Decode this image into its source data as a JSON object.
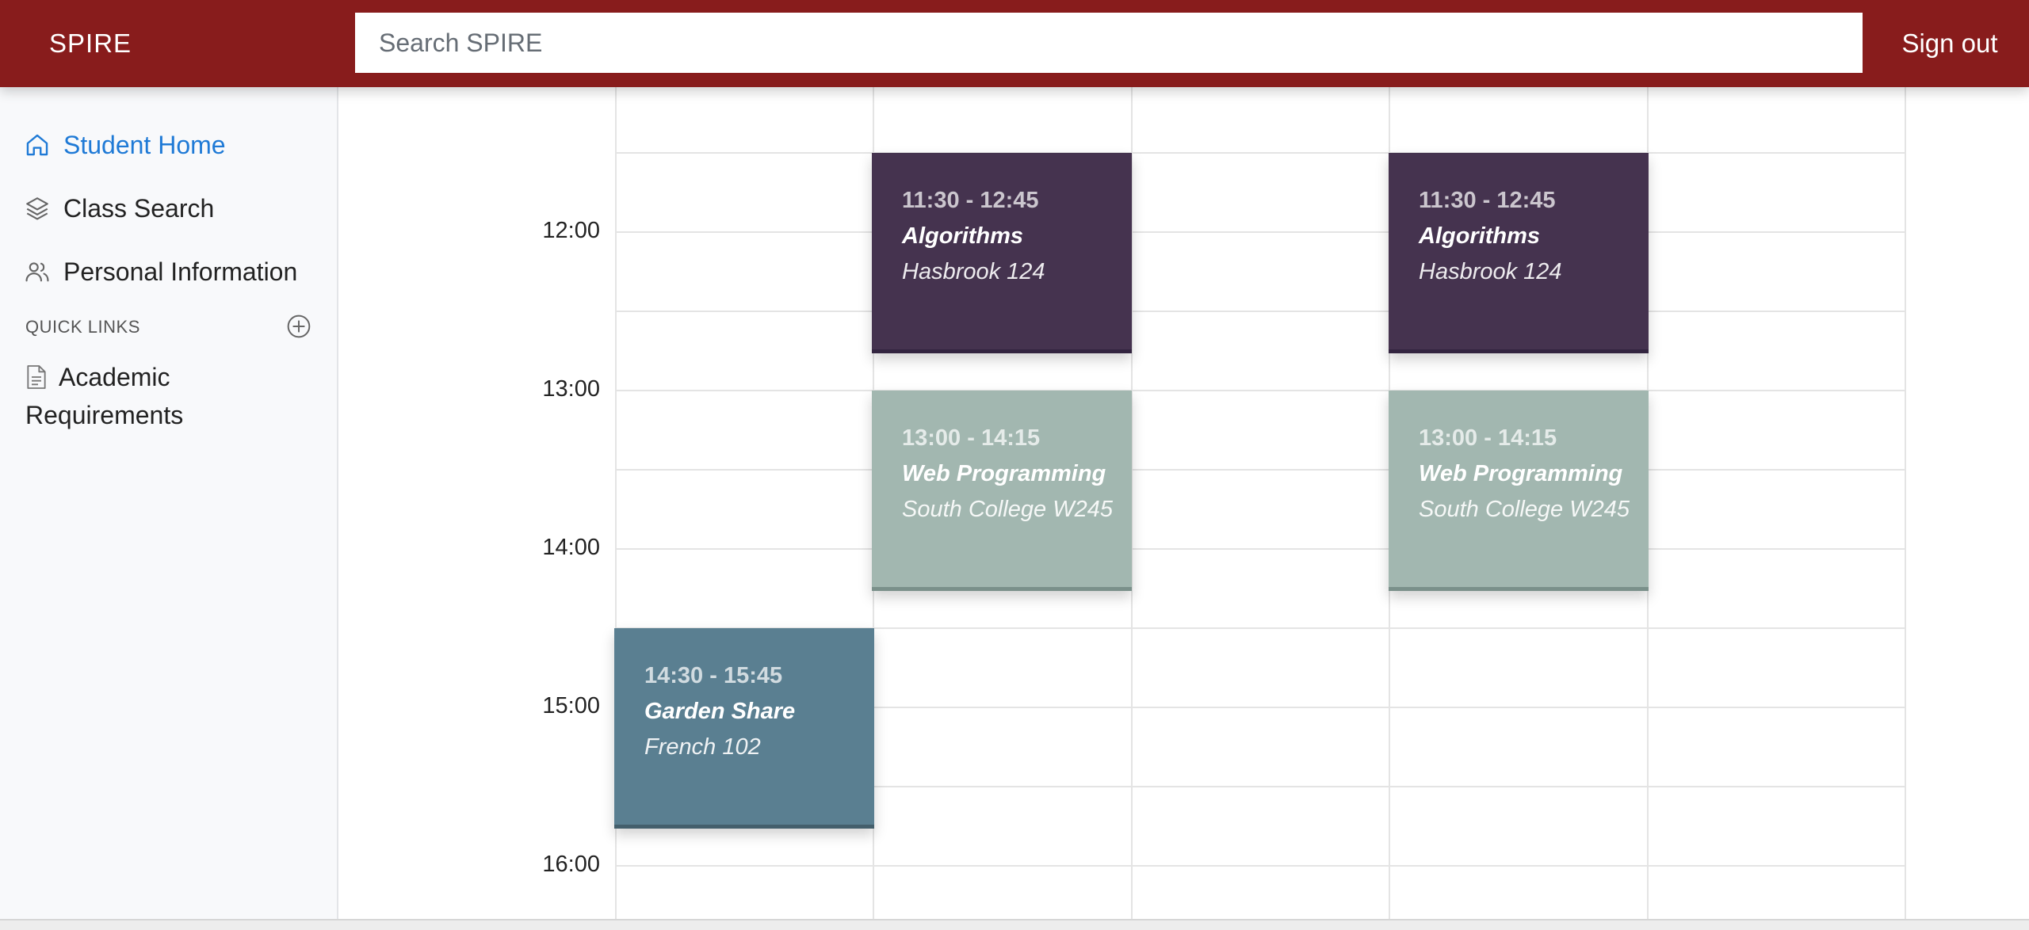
{
  "header": {
    "brand": "SPIRE",
    "search_placeholder": "Search SPIRE",
    "sign_out": "Sign out",
    "color": "#881c1c"
  },
  "sidebar": {
    "items": [
      {
        "label": "Student Home",
        "icon": "home-icon",
        "active": true
      },
      {
        "label": "Class Search",
        "icon": "layers-icon",
        "active": false
      },
      {
        "label": "Personal Information",
        "icon": "people-icon",
        "active": false
      }
    ],
    "quick_links": {
      "title": "QUICK LINKS",
      "add_icon": "plus-circle-icon",
      "links": [
        {
          "label": "Academic Requirements",
          "icon": "document-icon"
        }
      ]
    }
  },
  "calendar": {
    "times": [
      "12:00",
      "13:00",
      "14:00",
      "15:00",
      "16:00"
    ],
    "events": [
      {
        "time": "11:30 - 12:45",
        "name": "Algorithms",
        "room": "Hasbrook 124",
        "color": "#45334f"
      },
      {
        "time": "11:30 - 12:45",
        "name": "Algorithms",
        "room": "Hasbrook 124",
        "color": "#45334f"
      },
      {
        "time": "13:00 - 14:15",
        "name": "Web Programming",
        "room": "South College W245",
        "color": "#a2b7b0"
      },
      {
        "time": "13:00 - 14:15",
        "name": "Web Programming",
        "room": "South College W245",
        "color": "#a2b7b0"
      },
      {
        "time": "14:30 - 15:45",
        "name": "Garden Share",
        "room": "French 102",
        "color": "#5a7f91"
      }
    ]
  }
}
